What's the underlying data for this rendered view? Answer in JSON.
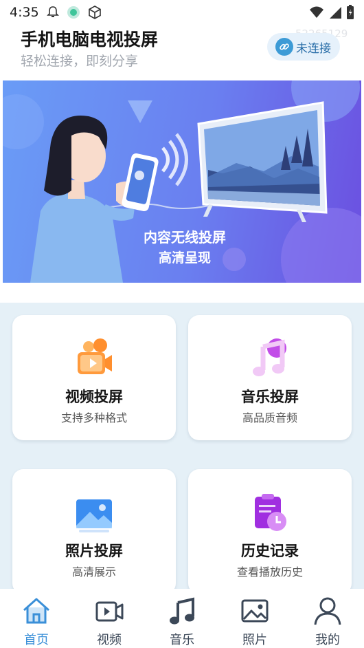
{
  "status_bar": {
    "time": "4:35",
    "icons": [
      "bell-icon",
      "app-badge-icon",
      "cube-icon",
      "wifi-icon",
      "signal-icon",
      "battery-icon"
    ]
  },
  "header": {
    "title": "手机电脑电视投屏",
    "subtitle": "轻松连接，即刻分享",
    "watermark": "52265129",
    "connect_button": {
      "label": "未连接",
      "icon": "link-icon"
    }
  },
  "banner": {
    "line1": "内容无线投屏",
    "line2": "高清呈现"
  },
  "features": [
    {
      "title": "视频投屏",
      "subtitle": "支持多种格式",
      "icon": "video-camera-icon"
    },
    {
      "title": "音乐投屏",
      "subtitle": "高品质音频",
      "icon": "music-note-icon"
    },
    {
      "title": "照片投屏",
      "subtitle": "高清展示",
      "icon": "picture-icon"
    },
    {
      "title": "历史记录",
      "subtitle": "查看播放历史",
      "icon": "history-clipboard-icon"
    }
  ],
  "bottom_nav": [
    {
      "label": "首页",
      "icon": "home-icon",
      "active": true
    },
    {
      "label": "视频",
      "icon": "video-icon",
      "active": false
    },
    {
      "label": "音乐",
      "icon": "music-icon",
      "active": false
    },
    {
      "label": "照片",
      "icon": "photo-icon",
      "active": false
    },
    {
      "label": "我的",
      "icon": "profile-icon",
      "active": false
    }
  ],
  "colors": {
    "accent": "#3a8fd8",
    "grid_background": "#e5f0f7",
    "banner_start": "#6a9cf6",
    "banner_end": "#6b4fe0"
  }
}
